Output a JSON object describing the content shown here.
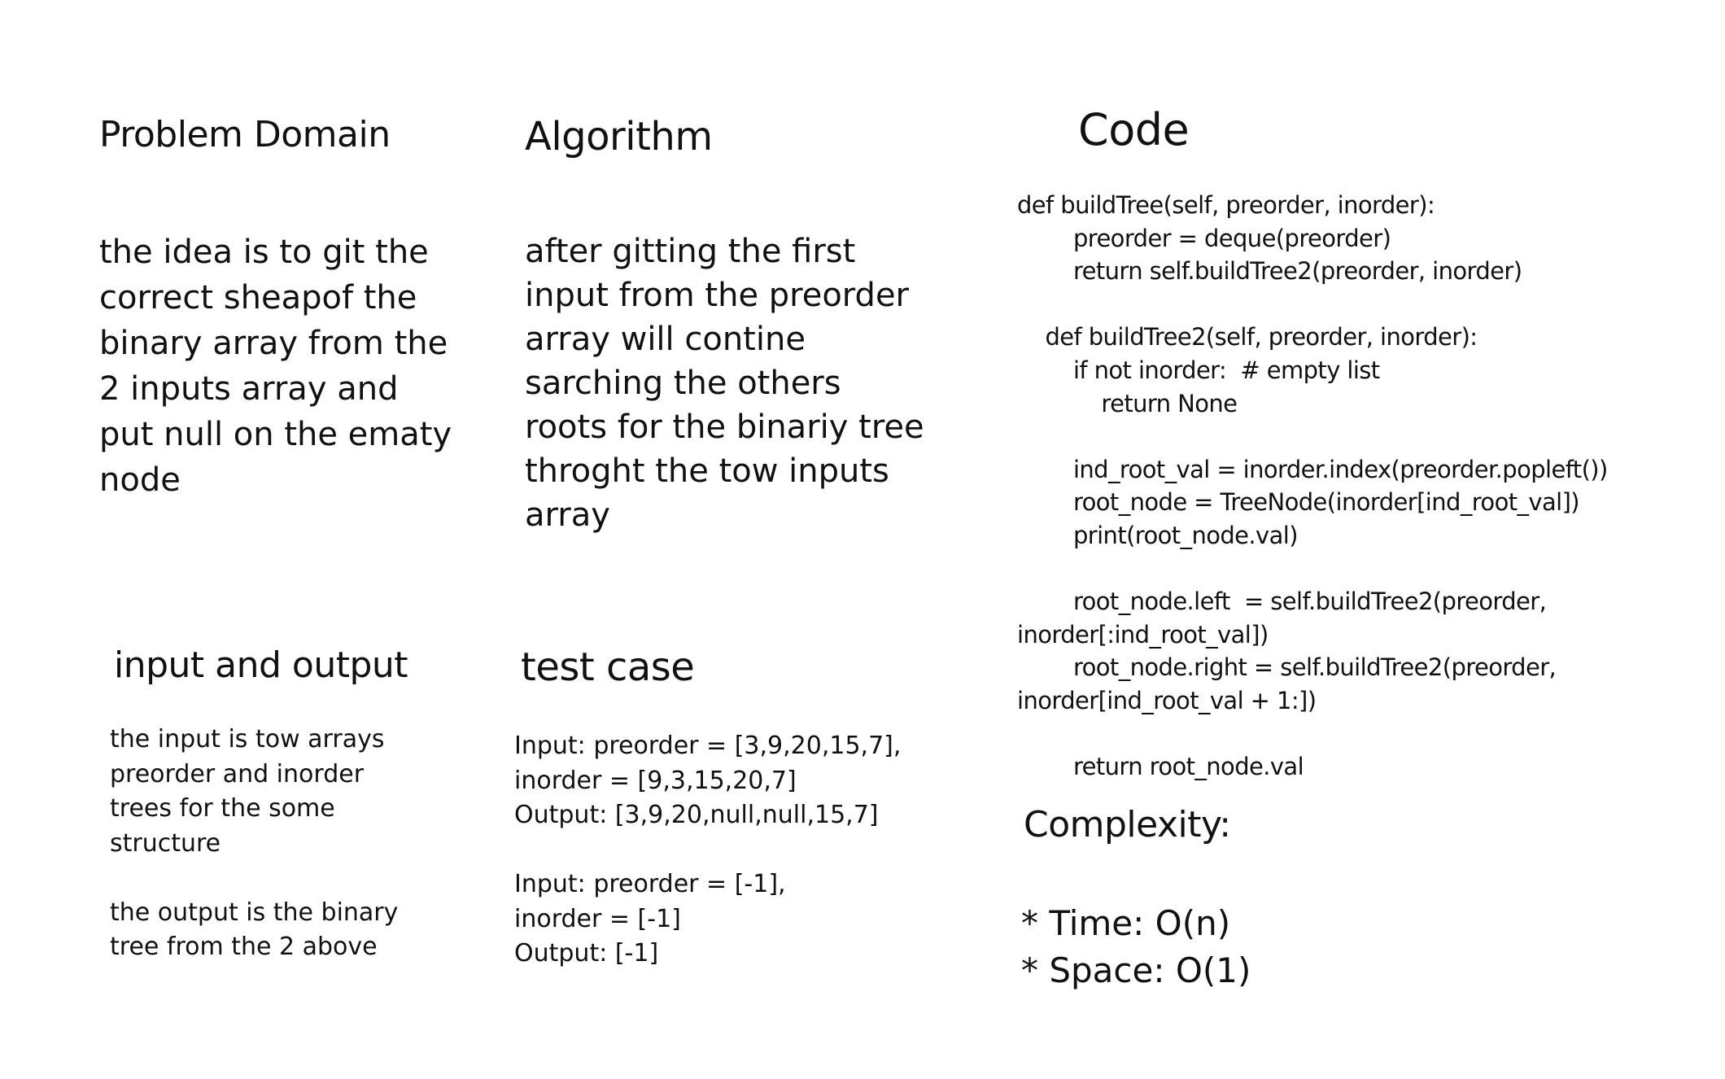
{
  "problem_domain": {
    "title": "Problem Domain",
    "body": "the idea is to git the\ncorrect sheapof the\nbinary array from the\n2 inputs array and\nput null on the ematy\nnode"
  },
  "algorithm": {
    "title": "Algorithm",
    "body": "after gitting the first\ninput from the preorder\narray will contine\nsarching the others\nroots for the binariy tree\nthroght the tow inputs\narray"
  },
  "code": {
    "title": "Code",
    "body": "def buildTree(self, preorder, inorder):\n        preorder = deque(preorder)\n        return self.buildTree2(preorder, inorder)\n\n    def buildTree2(self, preorder, inorder):\n        if not inorder:  # empty list\n            return None\n\n        ind_root_val = inorder.index(preorder.popleft())\n        root_node = TreeNode(inorder[ind_root_val])\n        print(root_node.val)\n\n        root_node.left  = self.buildTree2(preorder,\ninorder[:ind_root_val])\n        root_node.right = self.buildTree2(preorder,\ninorder[ind_root_val + 1:])\n\n        return root_node.val"
  },
  "input_output": {
    "title": "input and output",
    "body": "the input is tow arrays\npreorder and inorder\ntrees for the some\nstructure\n\nthe output is the binary\ntree from the 2 above"
  },
  "test_case": {
    "title": "test case",
    "body": "Input: preorder = [3,9,20,15,7],\ninorder = [9,3,15,20,7]\nOutput: [3,9,20,null,null,15,7]\n\nInput: preorder = [-1],\ninorder = [-1]\nOutput: [-1]"
  },
  "complexity": {
    "title": "Complexity:",
    "body": "* Time: O(n)\n* Space: O(1)"
  }
}
